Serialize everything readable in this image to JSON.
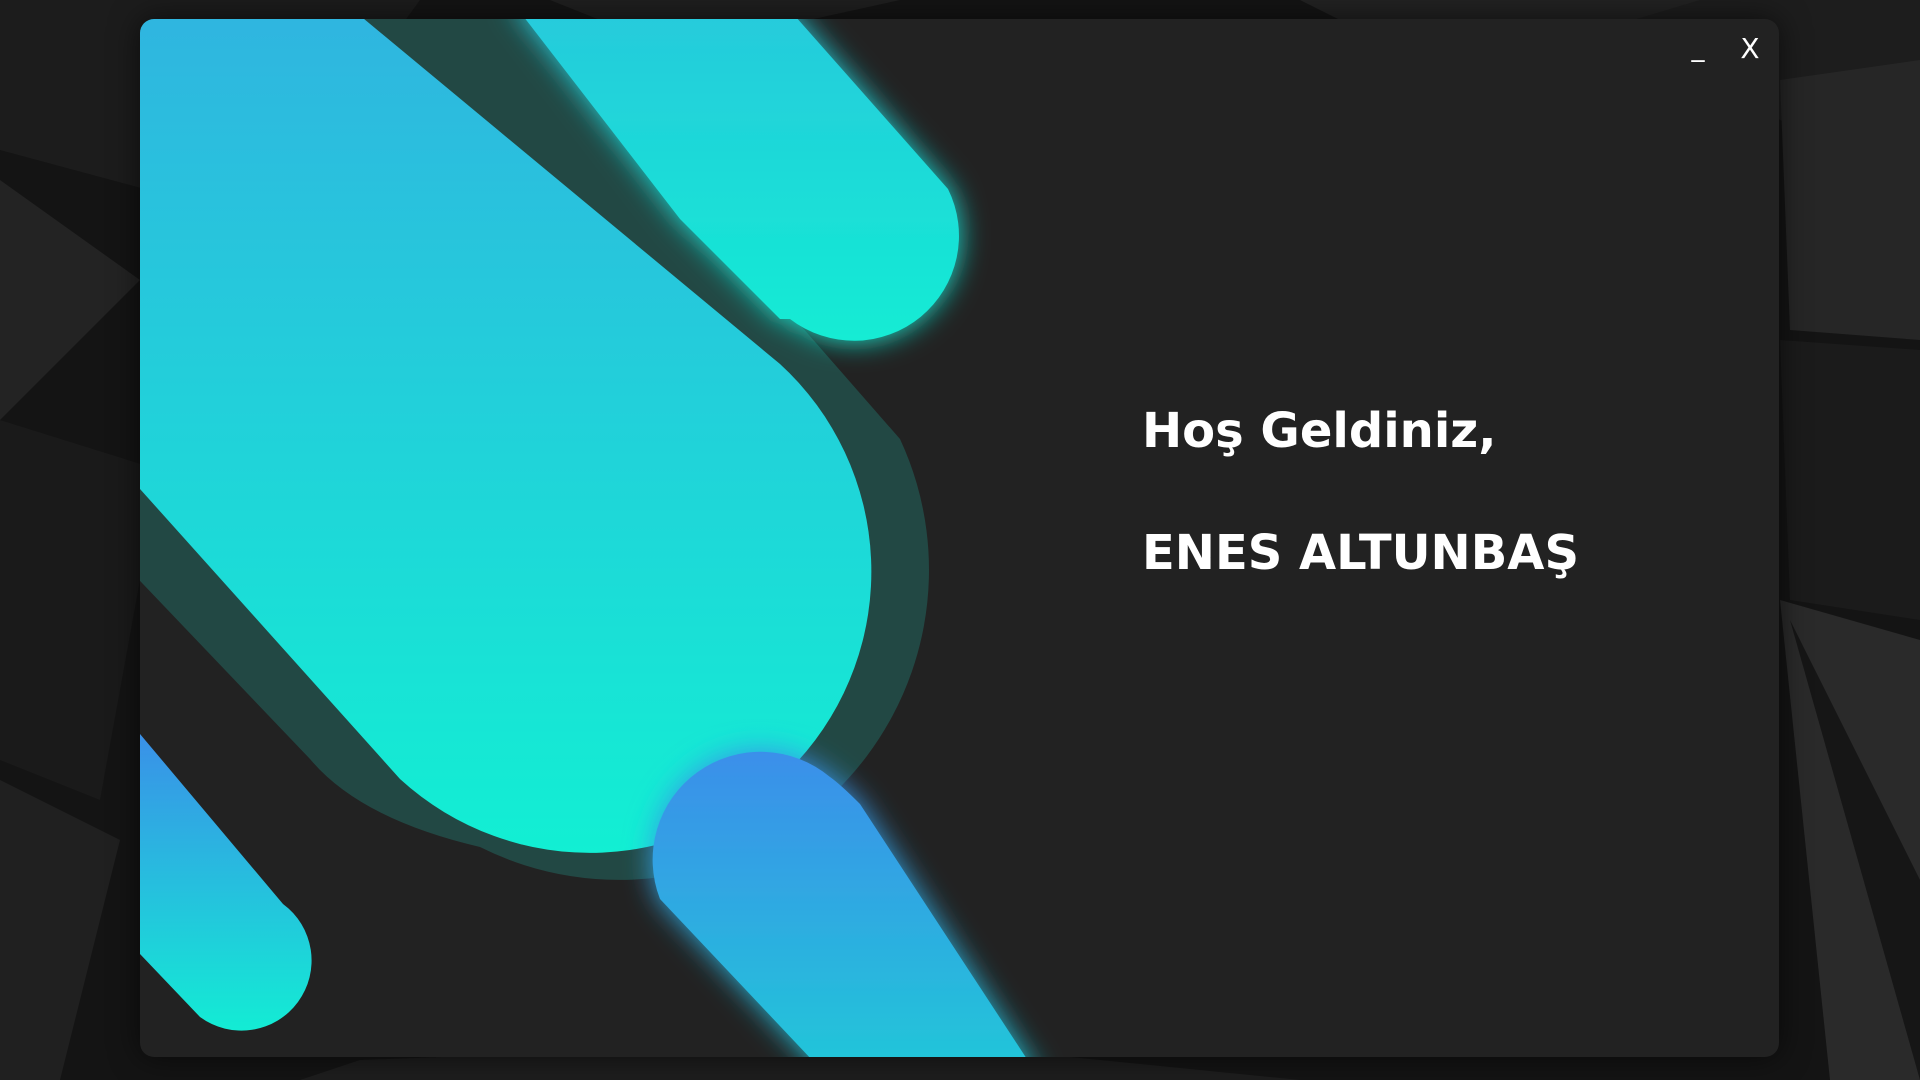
{
  "window": {
    "minimize_label": "_",
    "close_label": "X"
  },
  "welcome": {
    "greeting": "Hoş Geldiniz,",
    "user_name": "ENES ALTUNBAŞ"
  },
  "colors": {
    "window_bg": "#222222",
    "desktop_bg": "#121212",
    "accent_cyan": "#14EFD2",
    "accent_blue": "#3A8FEA",
    "shape_outline": "#224844",
    "text": "#FFFFFF"
  },
  "icons": {
    "minimize": "minimize-icon",
    "close": "close-icon"
  }
}
